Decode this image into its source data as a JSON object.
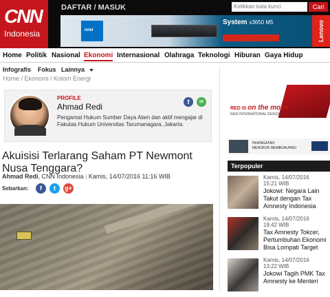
{
  "header": {
    "logo_main": "CNN",
    "logo_sub": "Indonesia",
    "auth_label": "DAFTAR / MASUK",
    "search_placeholder": "Ketikkan kata kunci",
    "search_button": "Cari"
  },
  "ad_banner": {
    "system_name": "System",
    "system_model": "x3650 M5",
    "brand": "Lenovo",
    "chip_label": "intel",
    "colors": {
      "brand_red": "#e2231a",
      "bg_blue": "#0c5b84"
    }
  },
  "nav": {
    "items": [
      "Home",
      "Politik",
      "Nasional",
      "Ekonomi",
      "Internasional",
      "Olahraga",
      "Teknologi",
      "Hiburan",
      "Gaya Hidup"
    ],
    "active": "Ekonomi"
  },
  "subnav": {
    "items": [
      "Infografis",
      "Fokus",
      "Lainnya"
    ]
  },
  "breadcrumb": "Home / Ekonomi / Kolom Energi",
  "profile": {
    "label": "PROFILE",
    "name": "Ahmad Redi",
    "description": "Pengamat Hukum Sumber Daya Alam dan aktif mengajar di Fakutas Hukum Universitas Tarumanagara, Jakarta."
  },
  "article": {
    "title": "Akuisisi Terlarang Saham PT Newmont Nusa Tenggara?",
    "author": "Ahmad Redi",
    "source": ", CNN Indonesia",
    "date": "Kamis, 14/07/2016 11:16 WIB",
    "share_label": "Sebarkan:"
  },
  "side_ad": {
    "redis_text": "RED IS",
    "redis_italic": "on the move",
    "intl_text": "NEW INTERNATIONAL DESIGN",
    "warning_title": "PERINGATAN:",
    "warning_text": "MEROKOK MEMBUNUHMU"
  },
  "terpopuler": {
    "heading": "Terpopuler",
    "items": [
      {
        "date": "Kamis, 14/07/2016",
        "time": "15:21 WIB",
        "title": "Jokowi: Negara Lain Takut dengan Tax Amnesty Indonesia"
      },
      {
        "date": "Kamis, 14/07/2016",
        "time": "19:42 WIB",
        "title": "Tax Amnesty Tokcer, Pertumbuhan Ekonomi Bisa Lompati Target"
      },
      {
        "date": "Kamis, 14/07/2016",
        "time": "13:22 WIB",
        "title": "Jokowi Tagih PMK Tax Amnesty ke Menteri"
      }
    ]
  },
  "colors": {
    "accent": "#c4161c",
    "facebook": "#3b5998",
    "twitter": "#1da1f2",
    "gplus": "#dd4b39"
  }
}
